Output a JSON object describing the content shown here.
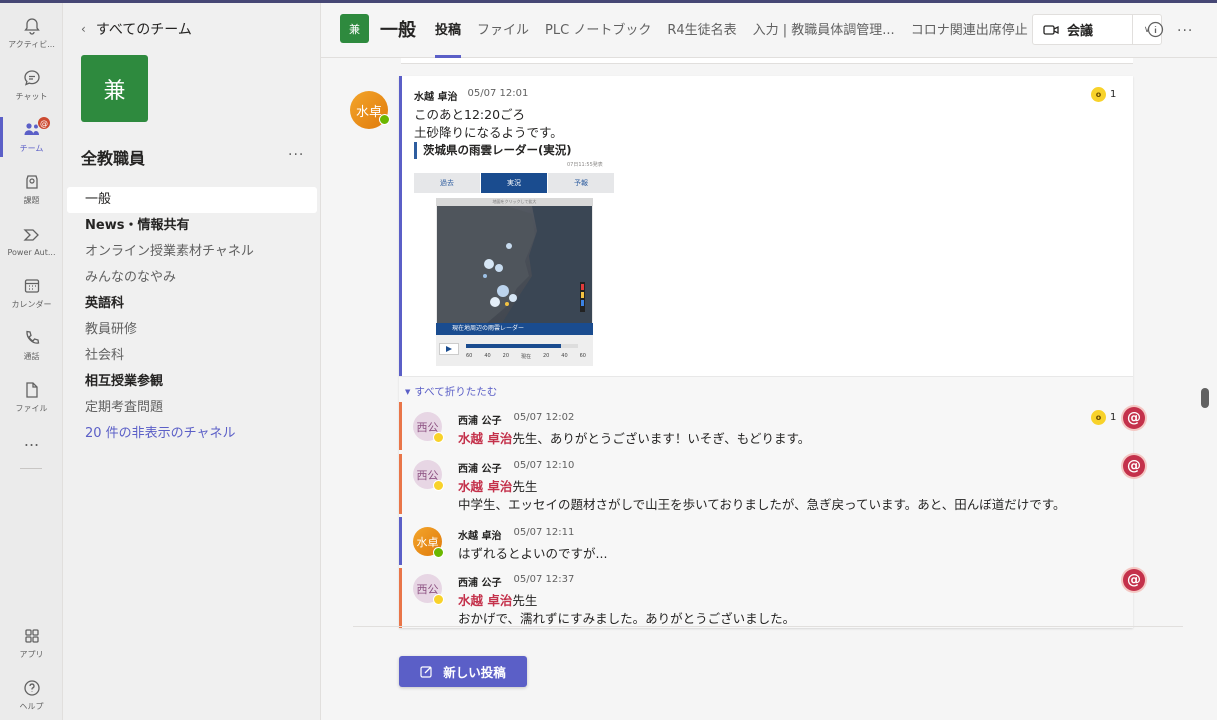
{
  "rail": {
    "items": [
      {
        "label": "アクティビ...",
        "icon": "bell-icon"
      },
      {
        "label": "チャット",
        "icon": "chat-icon"
      },
      {
        "label": "チーム",
        "icon": "teams-icon",
        "badge": "@"
      },
      {
        "label": "課題",
        "icon": "assignments-icon"
      },
      {
        "label": "Power Aut...",
        "icon": "power-automate-icon"
      },
      {
        "label": "カレンダー",
        "icon": "calendar-icon"
      },
      {
        "label": "通話",
        "icon": "phone-icon"
      },
      {
        "label": "ファイル",
        "icon": "file-icon"
      }
    ],
    "more": "...",
    "apps_label": "アプリ",
    "help_label": "ヘルプ"
  },
  "team": {
    "back_label": "すべてのチーム",
    "avatar_text": "兼",
    "name": "全教職員",
    "more": "...",
    "channels": [
      {
        "label": "一般"
      },
      {
        "label": "News・情報共有"
      },
      {
        "label": "オンライン授業素材チャネル"
      },
      {
        "label": "みんなのなやみ"
      },
      {
        "label": "英語科"
      },
      {
        "label": "教員研修"
      },
      {
        "label": "社会科"
      },
      {
        "label": "相互授業参観"
      },
      {
        "label": "定期考査問題"
      },
      {
        "label": "20 件の非表示のチャネル"
      }
    ]
  },
  "header": {
    "avatar_text": "兼",
    "title": "一般",
    "tabs": [
      "投稿",
      "ファイル",
      "PLC ノートブック",
      "R4生徒名表",
      "入力 | 教職員体調管理...",
      "コロナ関連出席停止"
    ],
    "meet_label": "会議",
    "more": "..."
  },
  "post": {
    "avatar_text": "水卓",
    "author": "水越 卓治",
    "time": "05/07 12:01",
    "lines": [
      "このあと12:20ごろ",
      "土砂降りになるようです。"
    ],
    "reaction_count": "1",
    "link_title": "茨城県の雨雲レーダー(実況)",
    "preview_date": "07日11:55発表",
    "weather_tabs": [
      "過去",
      "実況",
      "予報"
    ],
    "map_caption": "地図をクリックして拡大",
    "map_bar_text": "現在地周辺の雨雲レーダー",
    "timeline": [
      "60",
      "40",
      "20",
      "現在",
      "20",
      "40",
      "60"
    ]
  },
  "collapse_label": "すべて折りたたむ",
  "replies": [
    {
      "avatar_text": "西公",
      "author": "西浦 公子",
      "time": "05/07 12:02",
      "mention": "水越 卓治",
      "text_after": "先生、ありがとうございます！いそぎ、もどります。",
      "reaction_count": "1"
    },
    {
      "avatar_text": "西公",
      "author": "西浦 公子",
      "time": "05/07 12:10",
      "mention": "水越 卓治",
      "text_after": "先生",
      "line2": "中学生、エッセイの題材さがしで山王を歩いておりましたが、急ぎ戻っています。あと、田んぼ道だけです。"
    },
    {
      "avatar_text": "水卓",
      "author": "水越 卓治",
      "time": "05/07 12:11",
      "line1": "はずれるとよいのですが..."
    },
    {
      "avatar_text": "西公",
      "author": "西浦 公子",
      "time": "05/07 12:37",
      "mention": "水越 卓治",
      "text_after": "先生",
      "line2": "おかげで、濡れずにすみました。ありがとうございました。"
    }
  ],
  "new_post_label": "新しい投稿",
  "colors": {
    "accent": "#5b5fc7",
    "team_green": "#2e8a3e",
    "mention_red": "#c4314b",
    "reply_bar": "#e97548"
  }
}
